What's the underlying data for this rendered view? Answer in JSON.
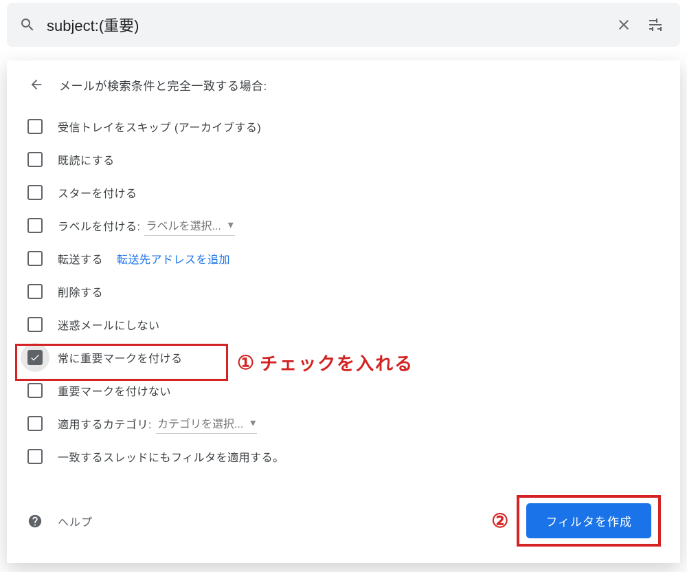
{
  "search": {
    "value": "subject:(重要)"
  },
  "header": {
    "title": "メールが検索条件と完全一致する場合:"
  },
  "options": {
    "skip_inbox": "受信トレイをスキップ (アーカイブする)",
    "mark_read": "既読にする",
    "star": "スターを付ける",
    "apply_label": "ラベルを付ける:",
    "label_select": "ラベルを選択...",
    "forward": "転送する",
    "forward_link": "転送先アドレスを追加",
    "delete": "削除する",
    "never_spam": "迷惑メールにしない",
    "always_important": "常に重要マークを付ける",
    "never_important": "重要マークを付けない",
    "categorize": "適用するカテゴリ:",
    "category_select": "カテゴリを選択...",
    "apply_matching": "一致するスレッドにもフィルタを適用する。"
  },
  "footer": {
    "help": "ヘルプ",
    "create": "フィルタを作成"
  },
  "annotation": {
    "num1": "①",
    "text1": "チェックを入れる",
    "num2": "②"
  }
}
